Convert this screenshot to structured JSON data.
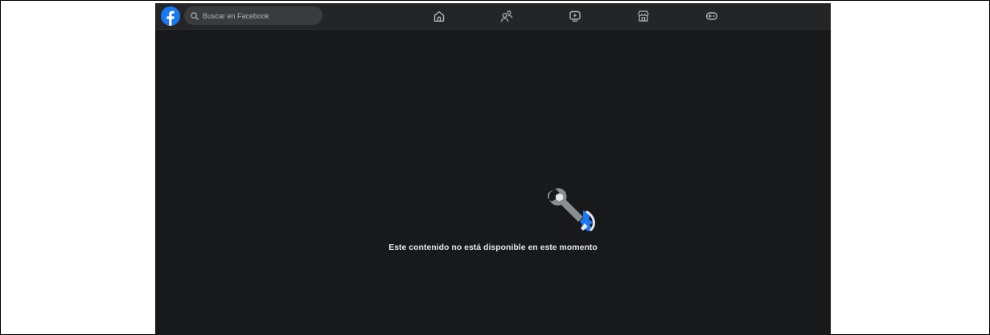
{
  "topbar": {
    "search": {
      "placeholder": "Buscar en Facebook"
    },
    "nav": [
      {
        "icon": "home-icon"
      },
      {
        "icon": "friends-icon"
      },
      {
        "icon": "watch-icon"
      },
      {
        "icon": "marketplace-icon"
      },
      {
        "icon": "gaming-icon"
      }
    ]
  },
  "content": {
    "message": "Este contenido no está disponible en este momento",
    "illustration_icon": "broken-wrench-icon"
  },
  "colors": {
    "brand_blue": "#1877f2",
    "background": "#18191a",
    "topbar": "#242526",
    "search_bg": "#3a3b3c",
    "text": "#e4e6eb"
  }
}
